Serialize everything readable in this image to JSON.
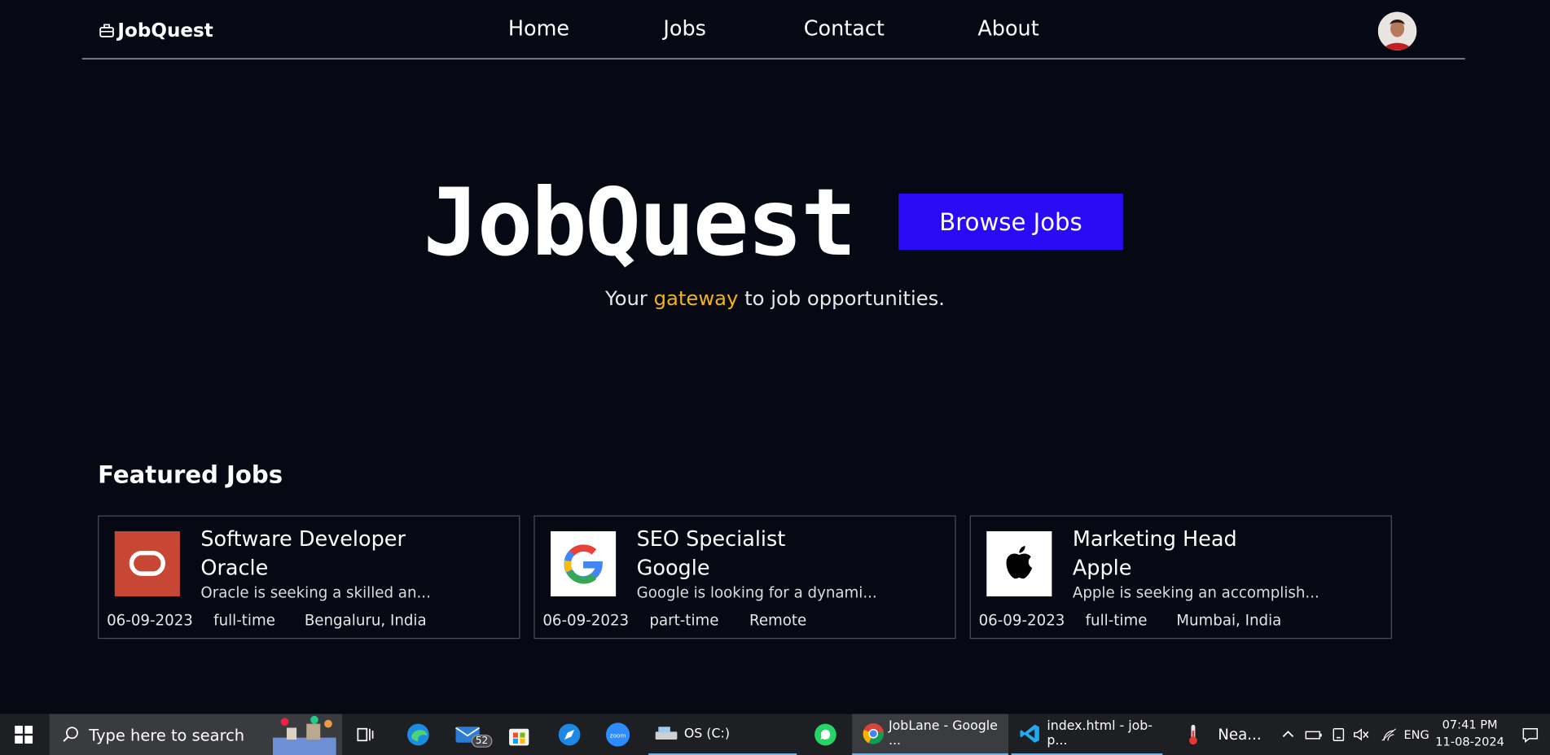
{
  "nav": {
    "brand": "JobQuest",
    "links": [
      "Home",
      "Jobs",
      "Contact",
      "About"
    ]
  },
  "hero": {
    "title": "JobQuest",
    "button": "Browse Jobs",
    "tagline_before": "Your ",
    "tagline_highlight": "gateway",
    "tagline_after": " to job opportunities.",
    "highlight_color": "#f2b316",
    "button_color": "#2a0bf6"
  },
  "featured": {
    "heading": "Featured Jobs",
    "jobs": [
      {
        "title": "Software Developer",
        "company": "Oracle",
        "desc": "Oracle is seeking a skilled an...",
        "date": "06-09-2023",
        "type": "full-time",
        "location": "Bengaluru, India",
        "logo": "oracle-logo"
      },
      {
        "title": "SEO Specialist",
        "company": "Google",
        "desc": "Google is looking for a dynami...",
        "date": "06-09-2023",
        "type": "part-time",
        "location": "Remote",
        "logo": "google-logo"
      },
      {
        "title": "Marketing Head",
        "company": "Apple",
        "desc": "Apple is seeking an accomplish...",
        "date": "06-09-2023",
        "type": "full-time",
        "location": "Mumbai, India",
        "logo": "apple-logo"
      }
    ]
  },
  "taskbar": {
    "search_placeholder": "Type here to search",
    "mail_badge": "52",
    "drive_label": "OS (C:)",
    "chrome_label": "JobLane - Google ...",
    "vscode_label": "index.html - job-p...",
    "weather_label": "Nea...",
    "lang": "ENG",
    "time": "07:41 PM",
    "date": "11-08-2024"
  }
}
